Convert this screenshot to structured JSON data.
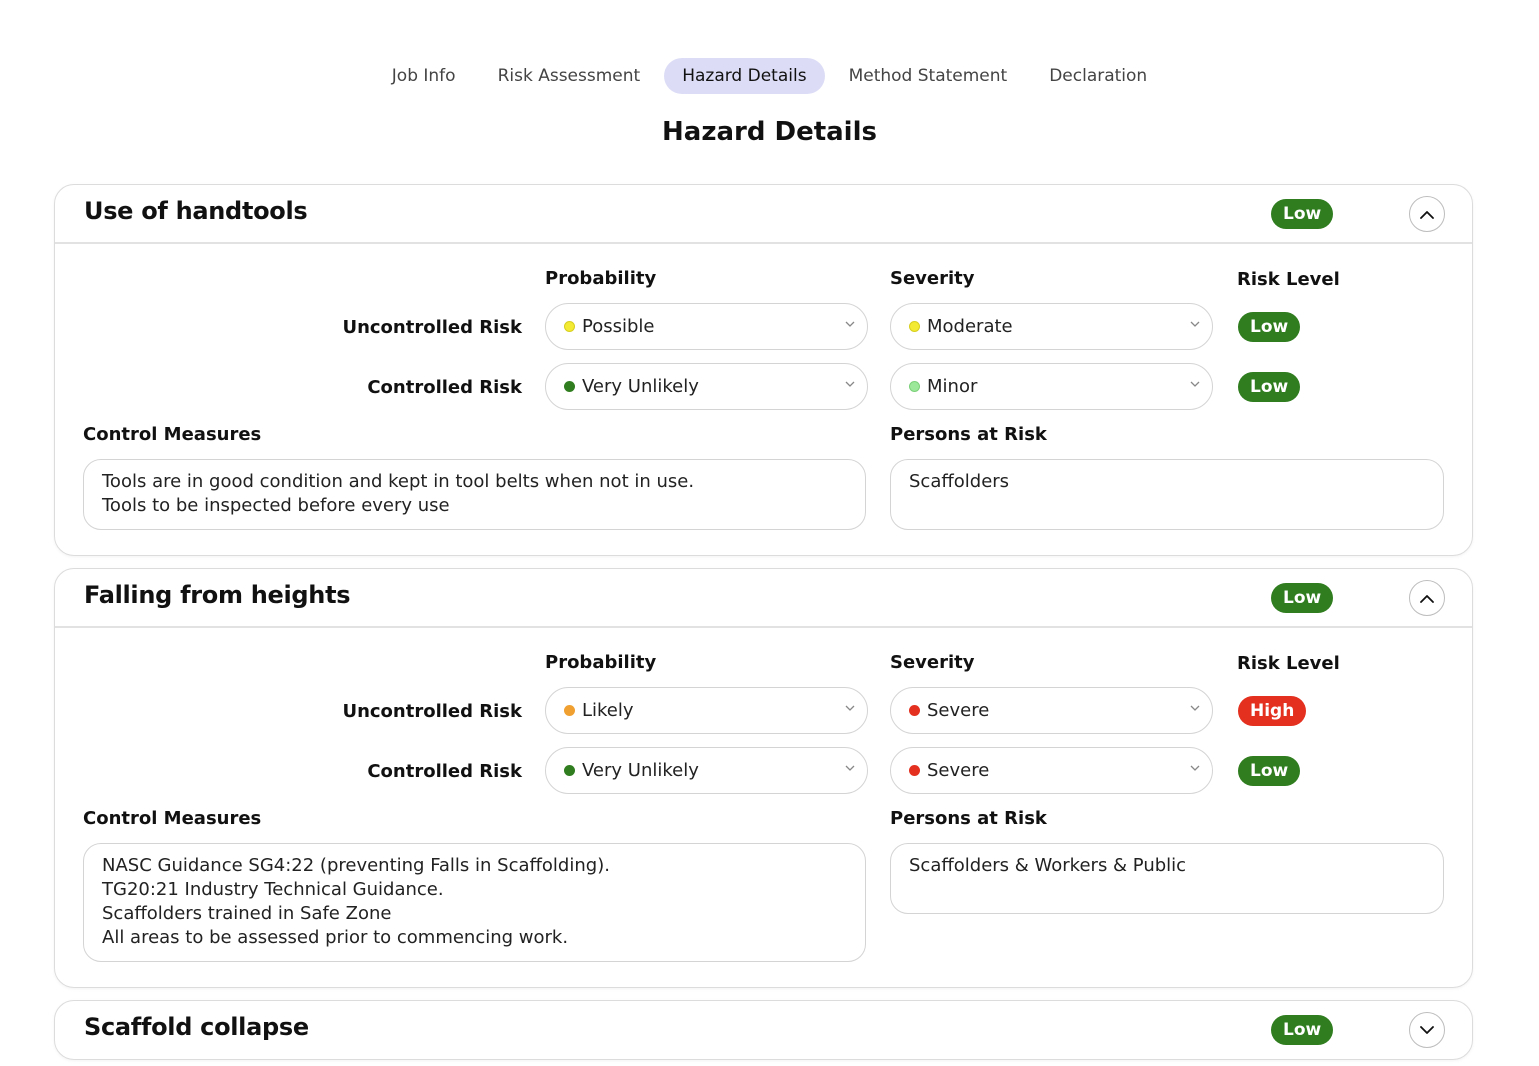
{
  "tabs": [
    {
      "label": "Job Info",
      "active": false
    },
    {
      "label": "Risk Assessment",
      "active": false
    },
    {
      "label": "Hazard Details",
      "active": true
    },
    {
      "label": "Method Statement",
      "active": false
    },
    {
      "label": "Declaration",
      "active": false
    }
  ],
  "page_title": "Hazard Details",
  "columns": {
    "probability": "Probability",
    "severity": "Severity",
    "risk_level": "Risk Level"
  },
  "row_labels": {
    "uncontrolled": "Uncontrolled Risk",
    "controlled": "Controlled Risk"
  },
  "section_labels": {
    "control_measures": "Control Measures",
    "persons_at_risk": "Persons at Risk"
  },
  "colors": {
    "low": "#2f7d1f",
    "high": "#e3301f",
    "active_tab": "#dcdcf7"
  },
  "hazards": [
    {
      "title": "Use of handtools",
      "overall_risk": "Low",
      "expanded": true,
      "uncontrolled": {
        "probability": {
          "value": "Possible",
          "dot": "yellow"
        },
        "severity": {
          "value": "Moderate",
          "dot": "yellow"
        },
        "risk_level": "Low"
      },
      "controlled": {
        "probability": {
          "value": "Very Unlikely",
          "dot": "darkgreen"
        },
        "severity": {
          "value": "Minor",
          "dot": "lightgreen"
        },
        "risk_level": "Low"
      },
      "control_measures": [
        "Tools are in good condition and kept in tool belts when not in use.",
        "Tools to be inspected before every use"
      ],
      "persons_at_risk": "Scaffolders"
    },
    {
      "title": "Falling from heights",
      "overall_risk": "Low",
      "expanded": true,
      "uncontrolled": {
        "probability": {
          "value": "Likely",
          "dot": "orange"
        },
        "severity": {
          "value": "Severe",
          "dot": "red"
        },
        "risk_level": "High"
      },
      "controlled": {
        "probability": {
          "value": "Very Unlikely",
          "dot": "darkgreen"
        },
        "severity": {
          "value": "Severe",
          "dot": "red"
        },
        "risk_level": "Low"
      },
      "control_measures": [
        "NASC Guidance SG4:22 (preventing Falls in Scaffolding).",
        "TG20:21 Industry Technical Guidance.",
        "Scaffolders trained in Safe Zone",
        "All areas to be assessed prior to commencing work."
      ],
      "persons_at_risk": "Scaffolders & Workers & Public"
    },
    {
      "title": "Scaffold collapse",
      "overall_risk": "Low",
      "expanded": false
    }
  ]
}
